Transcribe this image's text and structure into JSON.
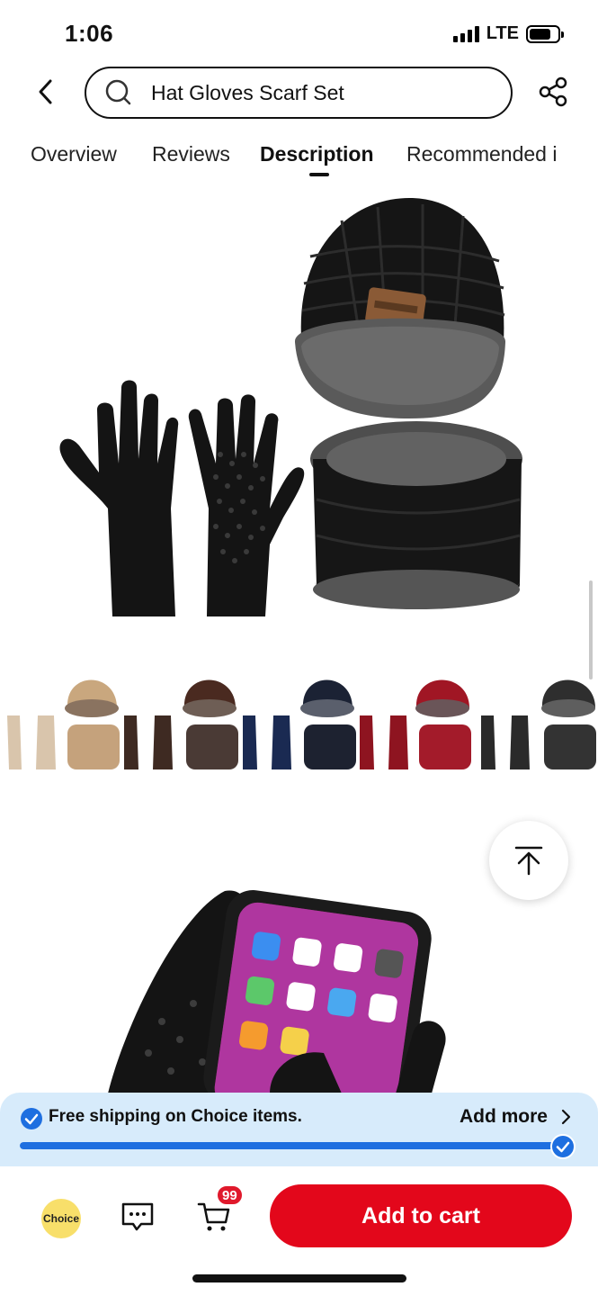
{
  "status_bar": {
    "time": "1:06",
    "network": "LTE"
  },
  "header": {
    "search_query": "Hat Gloves Scarf Set"
  },
  "tabs": [
    {
      "label": "Overview"
    },
    {
      "label": "Reviews"
    },
    {
      "label": "Description"
    },
    {
      "label": "Recommended i"
    }
  ],
  "active_tab": "Description",
  "content": {
    "color_variants": [
      "beige",
      "brown",
      "navy",
      "red",
      "dark gray"
    ]
  },
  "shipping_banner": {
    "prefix": "Free shipping on",
    "highlight": "Choice",
    "suffix": "items.",
    "add_more_label": "Add more",
    "progress": 1.0
  },
  "bottom_bar": {
    "choice_label": "Choice",
    "cart_count": "99",
    "add_to_cart_label": "Add to cart"
  },
  "colors": {
    "accent": "#e3071b",
    "banner_bg": "#d7ebfb",
    "progress": "#1e6fe0",
    "choice_badge": "#f8df6a"
  },
  "icons": [
    "back-chevron",
    "search",
    "share",
    "back-to-top",
    "check",
    "chevron-right",
    "message",
    "cart"
  ]
}
